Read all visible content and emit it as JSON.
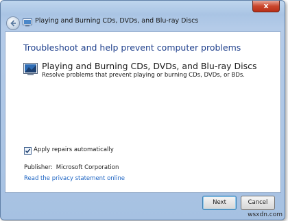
{
  "window": {
    "close_label": "x",
    "title": "Playing and Burning CDs, DVDs, and Blu-ray Discs"
  },
  "content": {
    "heading": "Troubleshoot and help prevent computer problems",
    "item_title": "Playing and Burning CDs, DVDs, and Blu-ray Discs",
    "item_description": "Resolve problems that prevent playing or burning CDs, DVDs, or BDs.",
    "apply_repairs_label": "Apply repairs automatically",
    "apply_repairs_checked": true,
    "publisher_label": "Publisher:",
    "publisher_value": "Microsoft Corporation",
    "privacy_link": "Read the privacy statement online"
  },
  "buttons": {
    "next": "Next",
    "cancel": "Cancel"
  },
  "watermark": "wsxdn.com",
  "icons": {
    "back": "back-arrow-icon",
    "title": "troubleshooter-icon",
    "item": "disc-drive-troubleshooter-icon",
    "checkbox": "checkmark-icon"
  }
}
